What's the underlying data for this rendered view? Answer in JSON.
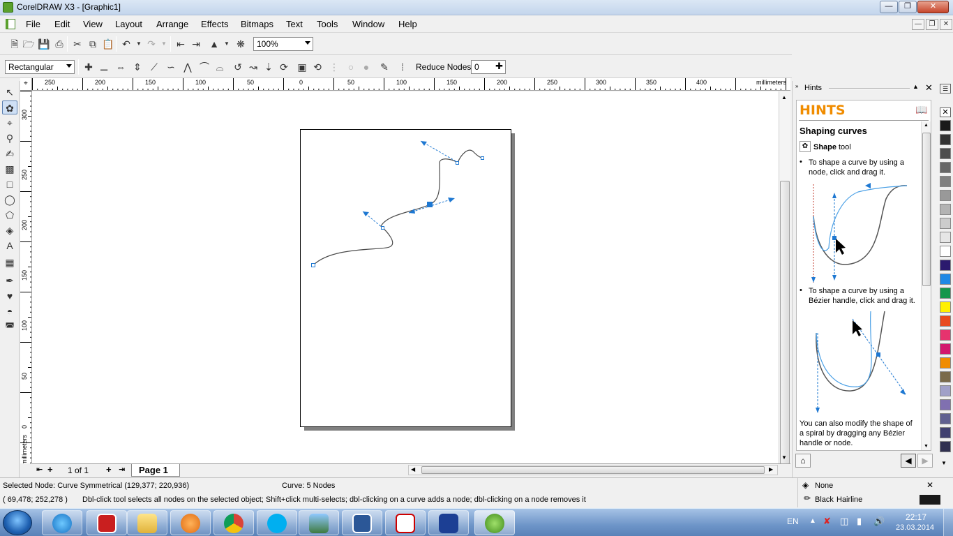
{
  "window": {
    "title": "CorelDRAW X3 - [Graphic1]"
  },
  "menu": [
    "File",
    "Edit",
    "View",
    "Layout",
    "Arrange",
    "Effects",
    "Bitmaps",
    "Text",
    "Tools",
    "Window",
    "Help"
  ],
  "standard_toolbar": {
    "zoom_value": "100%"
  },
  "property_bar": {
    "selection_mode": "Rectangular",
    "reduce_nodes_label": "Reduce Nodes",
    "reduce_nodes_value": "0"
  },
  "rulers": {
    "units": "millimeters",
    "h_labels": [
      "250",
      "200",
      "150",
      "100",
      "50",
      "0",
      "50",
      "100",
      "150",
      "200",
      "250",
      "300",
      "350",
      "400"
    ],
    "v_labels": [
      "300",
      "250",
      "200",
      "150",
      "100",
      "50",
      "0"
    ]
  },
  "page_nav": {
    "counter": "1 of 1",
    "page_tab": "Page 1"
  },
  "hints": {
    "panel_title": "Hints",
    "heading": "HINTS",
    "topic": "Shaping curves",
    "tool_name": "Shape",
    "tool_suffix": "tool",
    "bullet1": "To shape a curve by using a node, click and drag it.",
    "bullet2": "To shape a curve by using a Bézier handle, click and drag it.",
    "footer": "You can also modify the shape of a spiral by dragging any Bézier handle or node."
  },
  "status": {
    "selected_node": "Selected Node: Curve Symmetrical (129,377; 220,936)",
    "curve_info": "Curve: 5 Nodes",
    "coords": "( 69,478; 252,278 )",
    "hint_line": "Dbl-click tool selects all nodes on the selected object; Shift+click multi-selects; dbl-clicking on a curve adds a node; dbl-clicking on a node removes it",
    "fill": "None",
    "outline_color": "Black",
    "outline_width": "Hairline"
  },
  "taskbar": {
    "language": "EN",
    "time": "22:17",
    "date": "23.03.2014"
  },
  "colors": {
    "accent": "#f08c00",
    "handle": "#1e78d2",
    "palette": [
      "#1a1a1a",
      "#333333",
      "#4d4d4d",
      "#666666",
      "#808080",
      "#999999",
      "#b3b3b3",
      "#cccccc",
      "#e6e6e6",
      "#ffffff",
      "#2b1a6e",
      "#1e88e5",
      "#14964b",
      "#fff000",
      "#e84a1e",
      "#e6336e",
      "#d2186e",
      "#f08c00",
      "#7a6a4a",
      "#a0a0c8",
      "#8070b0",
      "#606090",
      "#404070",
      "#303050"
    ]
  }
}
